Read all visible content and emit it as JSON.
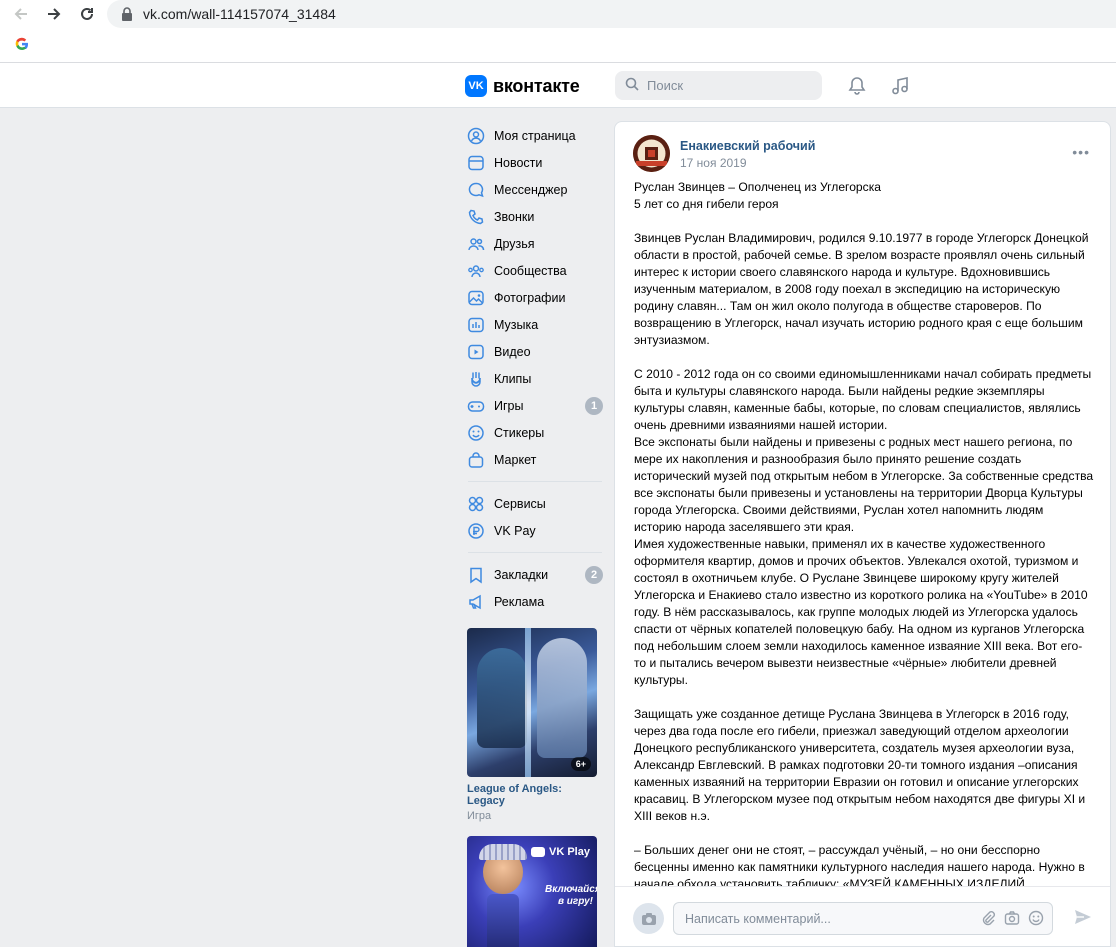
{
  "browser": {
    "url": "vk.com/wall-114157074_31484",
    "bookmark_logo": "G"
  },
  "header": {
    "logo_mark": "VK",
    "logo_text": "вконтакте",
    "search_placeholder": "Поиск"
  },
  "sidebar": {
    "items": [
      {
        "label": "Моя страница",
        "icon": "user-circle-icon"
      },
      {
        "label": "Новости",
        "icon": "newspaper-icon"
      },
      {
        "label": "Мессенджер",
        "icon": "message-icon"
      },
      {
        "label": "Звонки",
        "icon": "phone-icon"
      },
      {
        "label": "Друзья",
        "icon": "friends-icon"
      },
      {
        "label": "Сообщества",
        "icon": "communities-icon"
      },
      {
        "label": "Фотографии",
        "icon": "photo-icon"
      },
      {
        "label": "Музыка",
        "icon": "music-icon"
      },
      {
        "label": "Видео",
        "icon": "video-icon"
      },
      {
        "label": "Клипы",
        "icon": "clips-icon"
      },
      {
        "label": "Игры",
        "icon": "gamepad-icon",
        "count": "1"
      },
      {
        "label": "Стикеры",
        "icon": "sticker-icon"
      },
      {
        "label": "Маркет",
        "icon": "bag-icon"
      }
    ],
    "items2": [
      {
        "label": "Сервисы",
        "icon": "services-icon"
      },
      {
        "label": "VK Pay",
        "icon": "vkpay-icon"
      }
    ],
    "items3": [
      {
        "label": "Закладки",
        "icon": "bookmark-icon",
        "count": "2"
      },
      {
        "label": "Реклама",
        "icon": "megaphone-icon"
      }
    ]
  },
  "ads": [
    {
      "title": "League of Angels: Legacy",
      "subtitle": "Игра",
      "badge": "6+"
    },
    {
      "title": "",
      "subtitle": "",
      "brand": "VK Play",
      "tagline": "Включайся в игру!"
    }
  ],
  "post": {
    "author": "Енакиевский рабочий",
    "avatar_text": "ЕНАКИЕВСКИЙ РАБОЧИЙ",
    "date": "17 ноя 2019",
    "more": "•••",
    "paragraphs": [
      "Руслан Звинцев – Ополченец из Углегорска",
      "5 лет со дня гибели героя",
      "",
      "Звинцев Руслан Владимирович, родился 9.10.1977 в городе Углегорск Донецкой области в простой, рабочей семье. В зрелом возрасте проявлял очень сильный интерес к истории своего славянского народа и культуре. Вдохновившись изученным материалом, в 2008 году поехал в экспедицию на историческую родину славян... Там он жил около полугода в обществе староверов. По возвращению в Углегорск, начал изучать историю родного края с еще большим энтузиазмом.",
      "",
      "С 2010 - 2012 года он со своими единомышленниками начал собирать предметы быта и культуры славянского народа. Были найдены редкие экземпляры культуры славян, каменные бабы, которые, по словам специалистов, являлись очень древними изваяниями нашей истории.",
      "Все экспонаты были найдены и привезены с родных мест нашего региона, по мере их накопления и разнообразия было принято решение создать исторический музей под открытым небом в Углегорске. За собственные средства все экспонаты были привезены и установлены на территории Дворца Культуры города Углегорска. Своими действиями, Руслан хотел напомнить людям историю народа заселявшего эти края.",
      "Имея художественные навыки, применял их в качестве художественного оформителя квартир, домов и прочих объектов. Увлекался охотой, туризмом и состоял в охотничьем клубе. О Руслане Звинцеве широкому кругу жителей Углегорска и Енакиево стало известно из короткого ролика на «YouTube» в 2010 году. В нём рассказывалось, как группе молодых людей из Углегорска удалось спасти от чёрных копателей половецкую бабу. На одном из курганов Углегорска под небольшим слоем земли находилось каменное изваяние XIII века. Вот его-то и пытались вечером вывезти неизвестные «чёрные» любители древней культуры.",
      "",
      "Защищать уже созданное детище Руслана Звинцева в Углегорск в 2016 году, через два года после его гибели, приезжал заведующий отделом археологии Донецкого республиканского университета, создатель музея археологии вуза, Александр Евглевский. В рамках подготовки 20-ти томного издания –описания каменных изваяний на территории Евразии он готовил и описание углегорских красавиц. В Углегорском музее под открытым небом находятся две фигуры XI и XIII веков н.э.",
      "",
      "– Больших денег они не стоят, – рассуждал учёный, – но они бесспорно бесценны именно как памятники культурного наследия нашего народа. Нужно в начале обхода установить табличку: «МУЗЕЙ КАМЕННЫХ ИЗДЕЛИЙ. КУЛЬТУРНОЕ НАСЛЕДИЕ НАРОДА». Наши предки верили, что души умерших переселяются в"
    ]
  },
  "comment": {
    "placeholder": "Написать комментарий..."
  },
  "colors": {
    "accent": "#0077ff",
    "link": "#2a5885",
    "muted": "#818c99",
    "page_bg": "#edeef0"
  }
}
